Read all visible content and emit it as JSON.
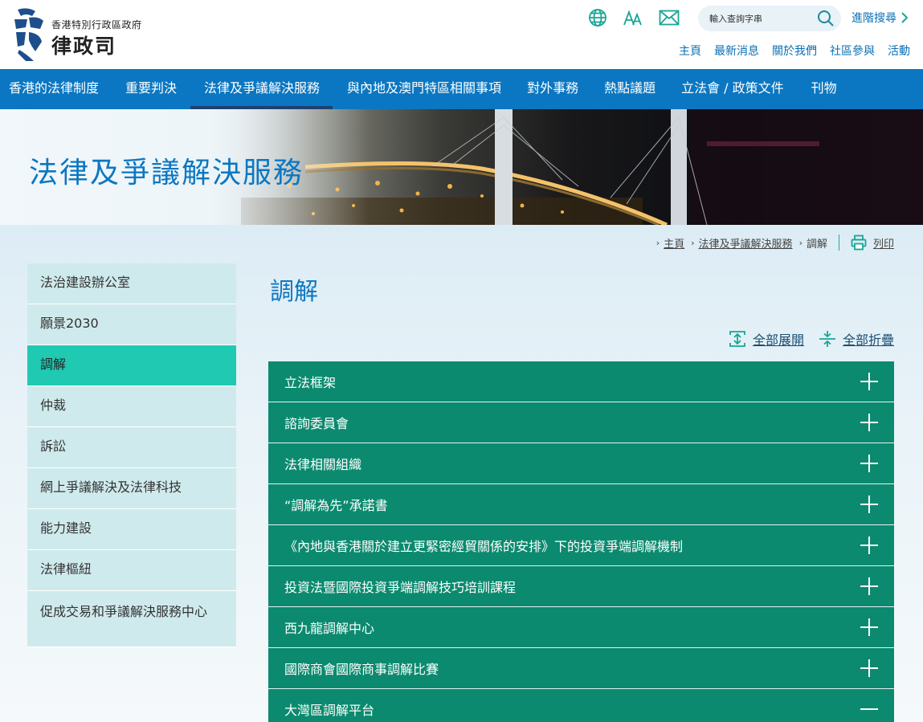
{
  "header": {
    "logo_subtitle": "香港特別行政區政府",
    "logo_title": "律政司",
    "search_placeholder": "輸入查詢字串",
    "advanced_search": "進階搜尋",
    "top_links": [
      "主頁",
      "最新消息",
      "關於我們",
      "社區參與",
      "活動"
    ],
    "accent_color": "#0b77c2",
    "icons": [
      "globe-icon",
      "font-size-icon",
      "mail-icon",
      "search-icon"
    ]
  },
  "mainnav": {
    "items": [
      "香港的法律制度",
      "重要判決",
      "法律及爭議解決服務",
      "與內地及澳門特區相關事項",
      "對外事務",
      "熱點議題",
      "立法會 / 政策文件",
      "刊物"
    ],
    "active_index": 2
  },
  "banner": {
    "title": "法律及爭議解決服務"
  },
  "breadcrumb": {
    "items": [
      "主頁",
      "法律及爭議解決服務",
      "調解"
    ],
    "print_label": "列印"
  },
  "sidebar": {
    "items": [
      "法治建設辦公室",
      "願景2030",
      "調解",
      "仲裁",
      "訴訟",
      "網上爭議解決及法律科技",
      "能力建設",
      "法律樞紐",
      "促成交易和爭議解決服務中心"
    ],
    "active_index": 2,
    "active_color": "#20c9b2"
  },
  "main": {
    "page_title": "調解",
    "expand_all": "全部展開",
    "collapse_all": "全部折疊",
    "accordion": [
      {
        "label": "立法框架",
        "expanded": false
      },
      {
        "label": "諮詢委員會",
        "expanded": false
      },
      {
        "label": "法律相關組織",
        "expanded": false
      },
      {
        "label": "“調解為先”承諾書",
        "expanded": false
      },
      {
        "label": "《內地與香港關於建立更緊密經貿關係的安排》下的投資爭端調解機制",
        "expanded": false
      },
      {
        "label": "投資法暨國際投資爭端調解技巧培訓課程",
        "expanded": false
      },
      {
        "label": "西九龍調解中心",
        "expanded": false
      },
      {
        "label": "國際商會國際商事調解比賽",
        "expanded": false
      },
      {
        "label": "大灣區調解平台",
        "expanded": true
      }
    ],
    "accordion_color": "#0b8a6f"
  }
}
